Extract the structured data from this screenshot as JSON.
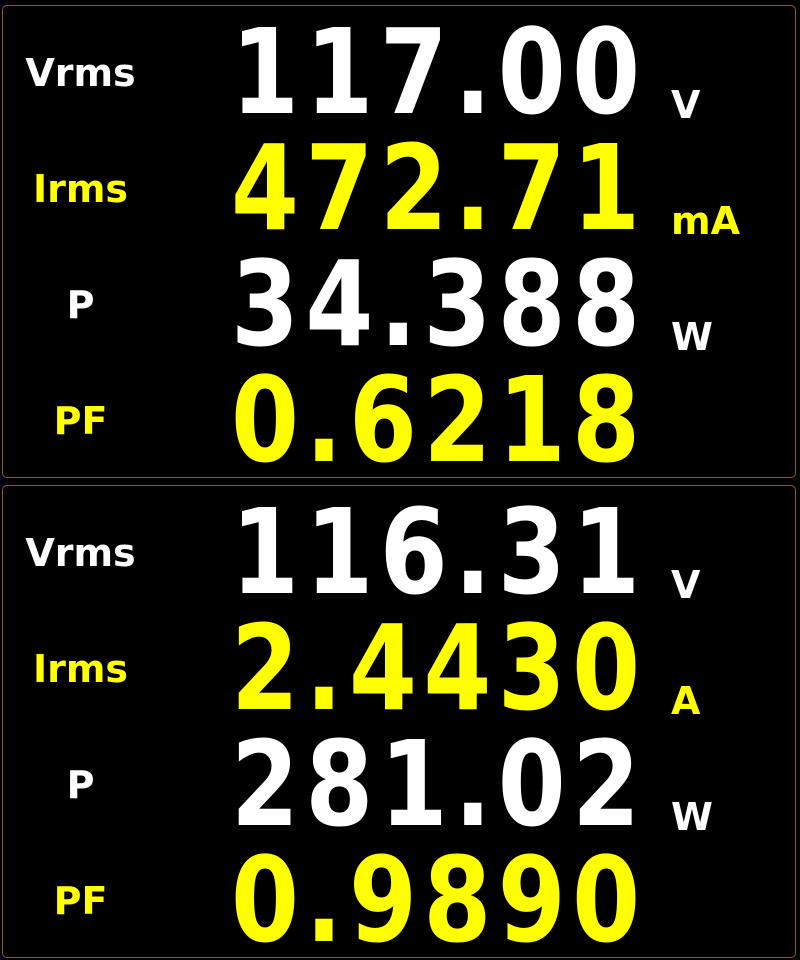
{
  "panels": [
    {
      "rows": [
        {
          "label": "Vrms",
          "value": "117.00",
          "unit": "V"
        },
        {
          "label": "Irms",
          "value": "472.71",
          "unit": "mA"
        },
        {
          "label": "P",
          "value": "34.388",
          "unit": "W"
        },
        {
          "label": "PF",
          "value": "0.6218",
          "unit": ""
        }
      ]
    },
    {
      "rows": [
        {
          "label": "Vrms",
          "value": "116.31",
          "unit": "V"
        },
        {
          "label": "Irms",
          "value": "2.4430",
          "unit": "A"
        },
        {
          "label": "P",
          "value": "281.02",
          "unit": "W"
        },
        {
          "label": "PF",
          "value": "0.9890",
          "unit": ""
        }
      ]
    }
  ],
  "colors": {
    "primary_text": "#ffffff",
    "accent_text": "#ffff00",
    "background": "#000000",
    "panel_border": "#8a5a1e"
  }
}
